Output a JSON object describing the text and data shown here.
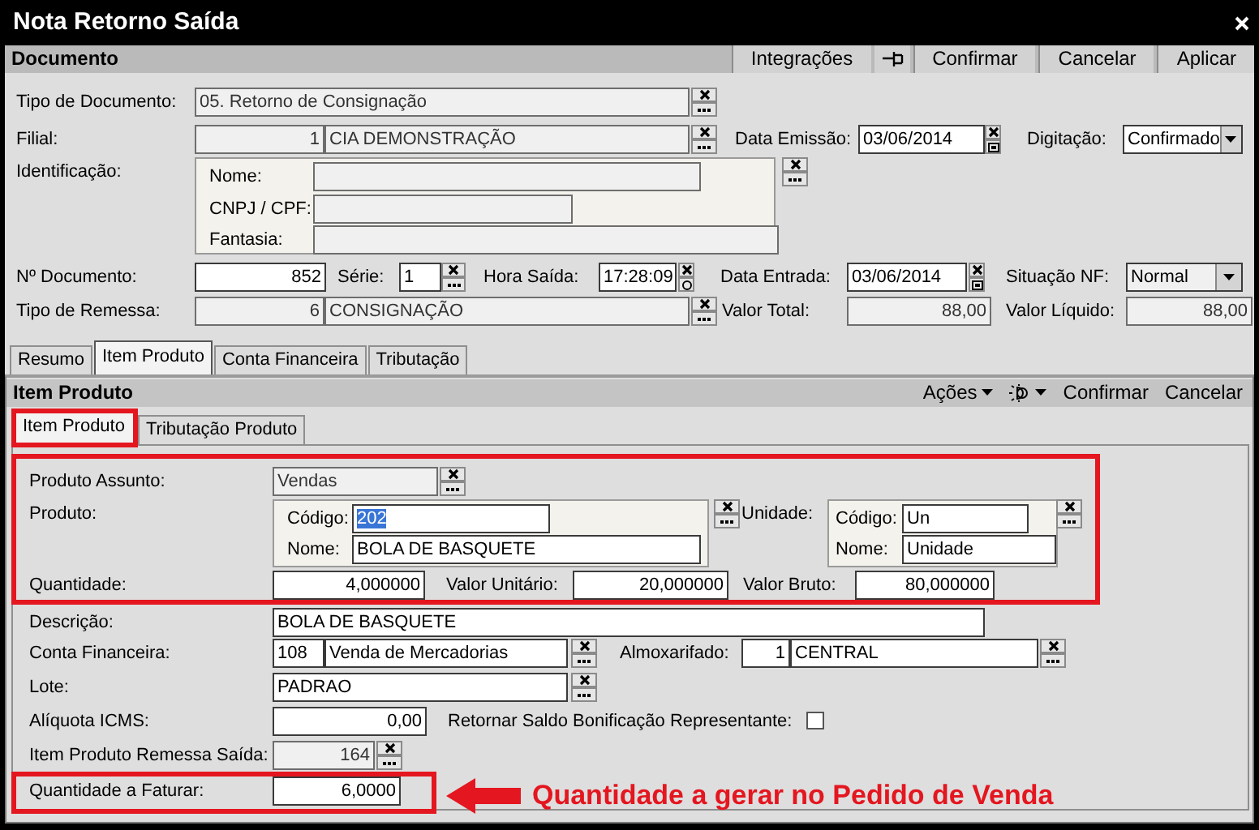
{
  "window": {
    "title": "Nota Retorno Saída"
  },
  "document": {
    "title": "Documento",
    "buttons": [
      {
        "kind": "button",
        "label": "Integrações"
      },
      {
        "kind": "pin"
      },
      {
        "kind": "button",
        "label": "Confirmar"
      },
      {
        "kind": "button",
        "label": "Cancelar"
      },
      {
        "kind": "button",
        "label": "Aplicar"
      }
    ],
    "rows": [
      {
        "items": [
          {
            "kind": "label",
            "text": "Tipo de Documento:"
          },
          {
            "kind": "field",
            "value": "05. Retorno de Consignação",
            "readonly": true
          },
          {
            "kind": "lookup"
          }
        ]
      },
      {
        "items": [
          {
            "kind": "label",
            "text": "Filial:"
          },
          {
            "kind": "field",
            "value": "1",
            "readonly": true,
            "right_aligned": true
          },
          {
            "kind": "field",
            "value": "CIA DEMONSTRAÇÃO",
            "readonly": true
          },
          {
            "kind": "lookup"
          },
          {
            "kind": "label",
            "text": "Data Emissão:"
          },
          {
            "kind": "field",
            "value": "03/06/2014",
            "readonly": false
          },
          {
            "kind": "date"
          },
          {
            "kind": "label",
            "text": "Digitação:"
          },
          {
            "kind": "dropdown",
            "value": "Confirmado",
            "readonly": false
          }
        ]
      },
      {
        "items": [
          {
            "kind": "label",
            "text": "Identificação:"
          },
          {
            "kind": "group",
            "rows": [
              {
                "items": [
                  {
                    "kind": "label",
                    "text": "Nome:"
                  },
                  {
                    "kind": "field",
                    "readonly": true
                  }
                ]
              },
              {
                "items": [
                  {
                    "kind": "label",
                    "text": "CNPJ / CPF:"
                  },
                  {
                    "kind": "field",
                    "readonly": true
                  }
                ]
              },
              {
                "items": [
                  {
                    "kind": "label",
                    "text": "Fantasia:"
                  },
                  {
                    "kind": "field",
                    "readonly": true
                  }
                ]
              }
            ]
          },
          {
            "kind": "lookup"
          }
        ]
      },
      {
        "items": [
          {
            "kind": "label",
            "text": "Nº Documento:"
          },
          {
            "kind": "field",
            "value": "852",
            "readonly": false,
            "right_aligned": true
          },
          {
            "kind": "label",
            "text": "Série:"
          },
          {
            "kind": "field",
            "value": "1",
            "readonly": false
          },
          {
            "kind": "lookup"
          },
          {
            "kind": "label",
            "text": "Hora Saída:"
          },
          {
            "kind": "field",
            "value": "17:28:09",
            "readonly": false
          },
          {
            "kind": "time"
          },
          {
            "kind": "label",
            "text": "Data Entrada:"
          },
          {
            "kind": "field",
            "value": "03/06/2014",
            "readonly": false
          },
          {
            "kind": "date"
          },
          {
            "kind": "label",
            "text": "Situação NF:"
          },
          {
            "kind": "dropdown",
            "value": "Normal",
            "readonly": true
          }
        ]
      },
      {
        "items": [
          {
            "kind": "label",
            "text": "Tipo de Remessa:"
          },
          {
            "kind": "field",
            "value": "6",
            "readonly": true,
            "right_aligned": true
          },
          {
            "kind": "field",
            "value": "CONSIGNAÇÃO",
            "readonly": true
          },
          {
            "kind": "lookup"
          },
          {
            "kind": "label",
            "text": "Valor Total:"
          },
          {
            "kind": "field",
            "value": "88,00",
            "readonly": true,
            "right_aligned": true
          },
          {
            "kind": "label",
            "text": "Valor Líquido:"
          },
          {
            "kind": "field",
            "value": "88,00",
            "readonly": true,
            "right_aligned": true
          }
        ]
      }
    ]
  },
  "tabs": [
    {
      "label": "Resumo",
      "selected": false
    },
    {
      "label": "Item Produto",
      "selected": true
    },
    {
      "label": "Conta Financeira",
      "selected": false
    },
    {
      "label": "Tributação",
      "selected": false
    }
  ],
  "item_panel": {
    "title": "Item Produto",
    "actions": [
      {
        "kind": "menu",
        "label": "Ações"
      },
      {
        "kind": "icon-menu"
      },
      {
        "kind": "button",
        "label": "Confirmar"
      },
      {
        "kind": "button",
        "label": "Cancelar"
      }
    ],
    "tabs": [
      {
        "label": "Item Produto",
        "selected": true
      },
      {
        "label": "Tributação Produto",
        "selected": false
      }
    ],
    "rows": [
      {
        "items": [
          {
            "kind": "label",
            "text": "Produto Assunto:"
          },
          {
            "kind": "field",
            "value": "Vendas",
            "readonly": true
          },
          {
            "kind": "lookup"
          }
        ]
      },
      {
        "items": [
          {
            "kind": "label",
            "text": "Produto:"
          },
          {
            "kind": "group",
            "rows": [
              {
                "items": [
                  {
                    "kind": "label",
                    "text": "Código:"
                  },
                  {
                    "kind": "field",
                    "value": "202",
                    "readonly": false,
                    "text_selected": true
                  }
                ]
              },
              {
                "items": [
                  {
                    "kind": "label",
                    "text": "Nome:"
                  },
                  {
                    "kind": "field",
                    "value": "BOLA DE BASQUETE",
                    "readonly": false
                  }
                ]
              }
            ]
          },
          {
            "kind": "lookup"
          },
          {
            "kind": "label",
            "text": "Unidade:"
          },
          {
            "kind": "group",
            "rows": [
              {
                "items": [
                  {
                    "kind": "label",
                    "text": "Código:"
                  },
                  {
                    "kind": "field",
                    "value": "Un",
                    "readonly": false
                  }
                ]
              },
              {
                "items": [
                  {
                    "kind": "label",
                    "text": "Nome:"
                  },
                  {
                    "kind": "field",
                    "value": "Unidade",
                    "readonly": false
                  }
                ]
              }
            ]
          },
          {
            "kind": "lookup"
          }
        ]
      },
      {
        "items": [
          {
            "kind": "label",
            "text": "Quantidade:"
          },
          {
            "kind": "field",
            "value": "4,000000",
            "readonly": false,
            "right_aligned": true
          },
          {
            "kind": "label",
            "text": "Valor Unitário:"
          },
          {
            "kind": "field",
            "value": "20,000000",
            "readonly": false,
            "right_aligned": true
          },
          {
            "kind": "label",
            "text": "Valor Bruto:"
          },
          {
            "kind": "field",
            "value": "80,000000",
            "readonly": false,
            "right_aligned": true
          }
        ]
      },
      {
        "items": [
          {
            "kind": "label",
            "text": "Descrição:"
          },
          {
            "kind": "field",
            "value": "BOLA DE BASQUETE",
            "readonly": false
          }
        ]
      },
      {
        "items": [
          {
            "kind": "label",
            "text": "Conta Financeira:"
          },
          {
            "kind": "field",
            "value": "108",
            "readonly": false
          },
          {
            "kind": "field",
            "value": "Venda de Mercadorias",
            "readonly": false
          },
          {
            "kind": "lookup"
          },
          {
            "kind": "label",
            "text": "Almoxarifado:"
          },
          {
            "kind": "field",
            "value": "1",
            "readonly": false,
            "right_aligned": true
          },
          {
            "kind": "field",
            "value": "CENTRAL",
            "readonly": false
          },
          {
            "kind": "lookup"
          }
        ]
      },
      {
        "items": [
          {
            "kind": "label",
            "text": "Lote:"
          },
          {
            "kind": "field",
            "value": "PADRAO",
            "readonly": false
          },
          {
            "kind": "lookup"
          }
        ]
      },
      {
        "items": [
          {
            "kind": "label",
            "text": "Alíquota ICMS:"
          },
          {
            "kind": "field",
            "value": "0,00",
            "readonly": false,
            "right_aligned": true
          },
          {
            "kind": "label",
            "text": "Retornar Saldo Bonificação Representante:"
          },
          {
            "kind": "checkbox",
            "checked": false
          }
        ]
      },
      {
        "items": [
          {
            "kind": "label",
            "text": "Item Produto Remessa Saída:"
          },
          {
            "kind": "field",
            "value": "164",
            "readonly": true,
            "right_aligned": true
          },
          {
            "kind": "lookup"
          }
        ]
      },
      {
        "items": [
          {
            "kind": "label",
            "text": "Quantidade a Faturar:"
          },
          {
            "kind": "field",
            "value": "6,0000",
            "readonly": false,
            "right_aligned": true
          },
          {
            "kind": "callout",
            "text": "Quantidade a gerar no Pedido de Venda"
          }
        ]
      }
    ]
  }
}
